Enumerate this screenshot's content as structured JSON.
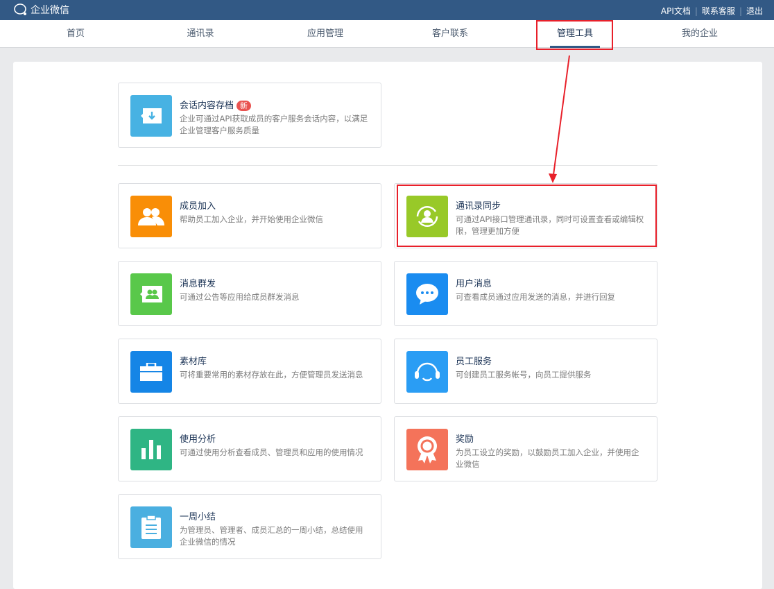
{
  "header": {
    "logo": "企业微信",
    "links": [
      "API文档",
      "联系客服",
      "退出"
    ]
  },
  "nav": {
    "tabs": [
      "首页",
      "通讯录",
      "应用管理",
      "客户联系",
      "管理工具",
      "我的企业"
    ],
    "active": 4
  },
  "featured": {
    "title": "会话内容存档",
    "badge": "新",
    "desc": "企业可通过API获取成员的客户服务会话内容，以满足企业管理客户服务质量",
    "color": "#47b2e3"
  },
  "cards": [
    {
      "title": "成员加入",
      "desc": "帮助员工加入企业，并开始使用企业微信",
      "color": "#f98e07",
      "icon": "members-icon"
    },
    {
      "title": "通讯录同步",
      "desc": "可通过API接口管理通讯录，同时可设置查看或编辑权限，管理更加方便",
      "color": "#98c928",
      "icon": "sync-contacts-icon"
    },
    {
      "title": "消息群发",
      "desc": "可通过公告等应用给成员群发消息",
      "color": "#59c84a",
      "icon": "broadcast-icon"
    },
    {
      "title": "用户消息",
      "desc": "可查看成员通过应用发送的消息，并进行回复",
      "color": "#1a8cf0",
      "icon": "chat-bubble-icon"
    },
    {
      "title": "素材库",
      "desc": "可将重要常用的素材存放在此，方便管理员发送消息",
      "color": "#1585e6",
      "icon": "briefcase-icon"
    },
    {
      "title": "员工服务",
      "desc": "可创建员工服务帐号，向员工提供服务",
      "color": "#2a9df4",
      "icon": "headset-icon"
    },
    {
      "title": "使用分析",
      "desc": "可通过使用分析查看成员、管理员和应用的使用情况",
      "color": "#2fb584",
      "icon": "bar-chart-icon"
    },
    {
      "title": "奖励",
      "desc": "为员工设立的奖励，以鼓励员工加入企业，并使用企业微信",
      "color": "#f4735a",
      "icon": "award-icon"
    },
    {
      "title": "一周小结",
      "desc": "为管理员、管理者、成员汇总的一周小结，总结使用企业微信的情况",
      "color": "#4aafe0",
      "icon": "clipboard-icon"
    }
  ]
}
